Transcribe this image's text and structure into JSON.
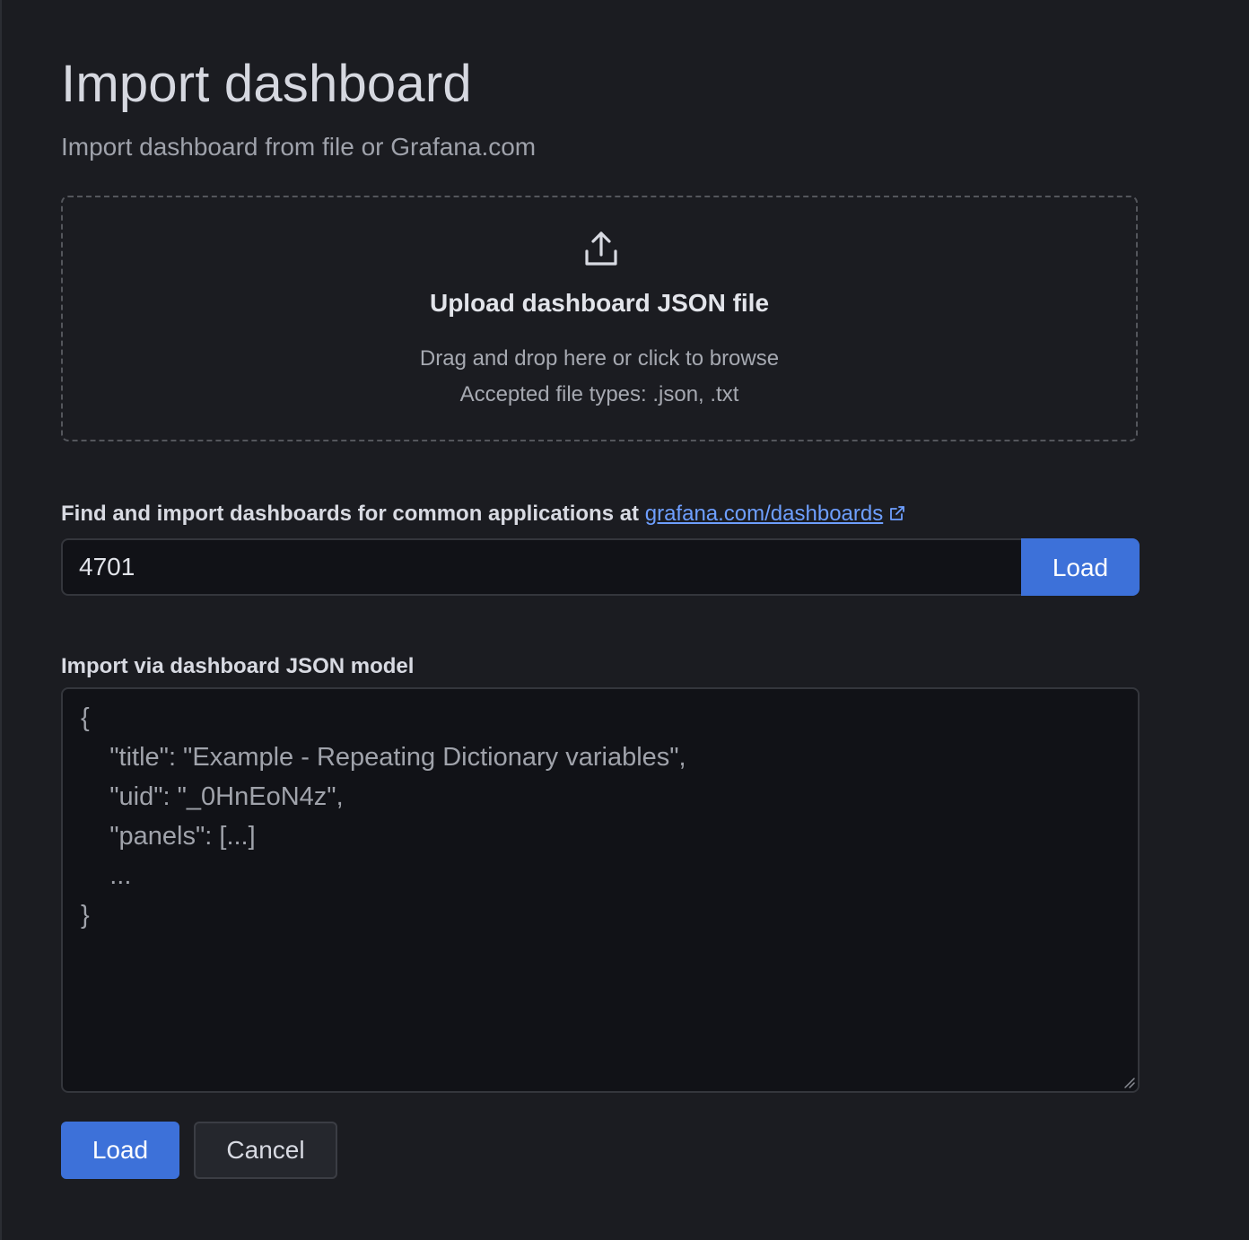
{
  "header": {
    "title": "Import dashboard",
    "subtitle": "Import dashboard from file or Grafana.com"
  },
  "upload": {
    "icon": "upload-icon",
    "title": "Upload dashboard JSON file",
    "hint": "Drag and drop here or click to browse",
    "accepted": "Accepted file types: .json, .txt"
  },
  "grafana_com": {
    "label": "Find and import dashboards for common applications at",
    "link_text": "grafana.com/dashboards",
    "link_icon": "external-link-icon",
    "input_value": "4701",
    "load_label": "Load"
  },
  "json_model": {
    "label": "Import via dashboard JSON model",
    "placeholder_lines": [
      "{",
      "    \"title\": \"Example - Repeating Dictionary variables\",",
      "    \"uid\": \"_0HnEoN4z\",",
      "    \"panels\": [...]",
      "    ...",
      "}"
    ]
  },
  "actions": {
    "load_label": "Load",
    "cancel_label": "Cancel"
  },
  "colors": {
    "background": "#1b1c21",
    "input_background": "#111217",
    "primary": "#3d71d9",
    "link": "#6e9fff"
  }
}
